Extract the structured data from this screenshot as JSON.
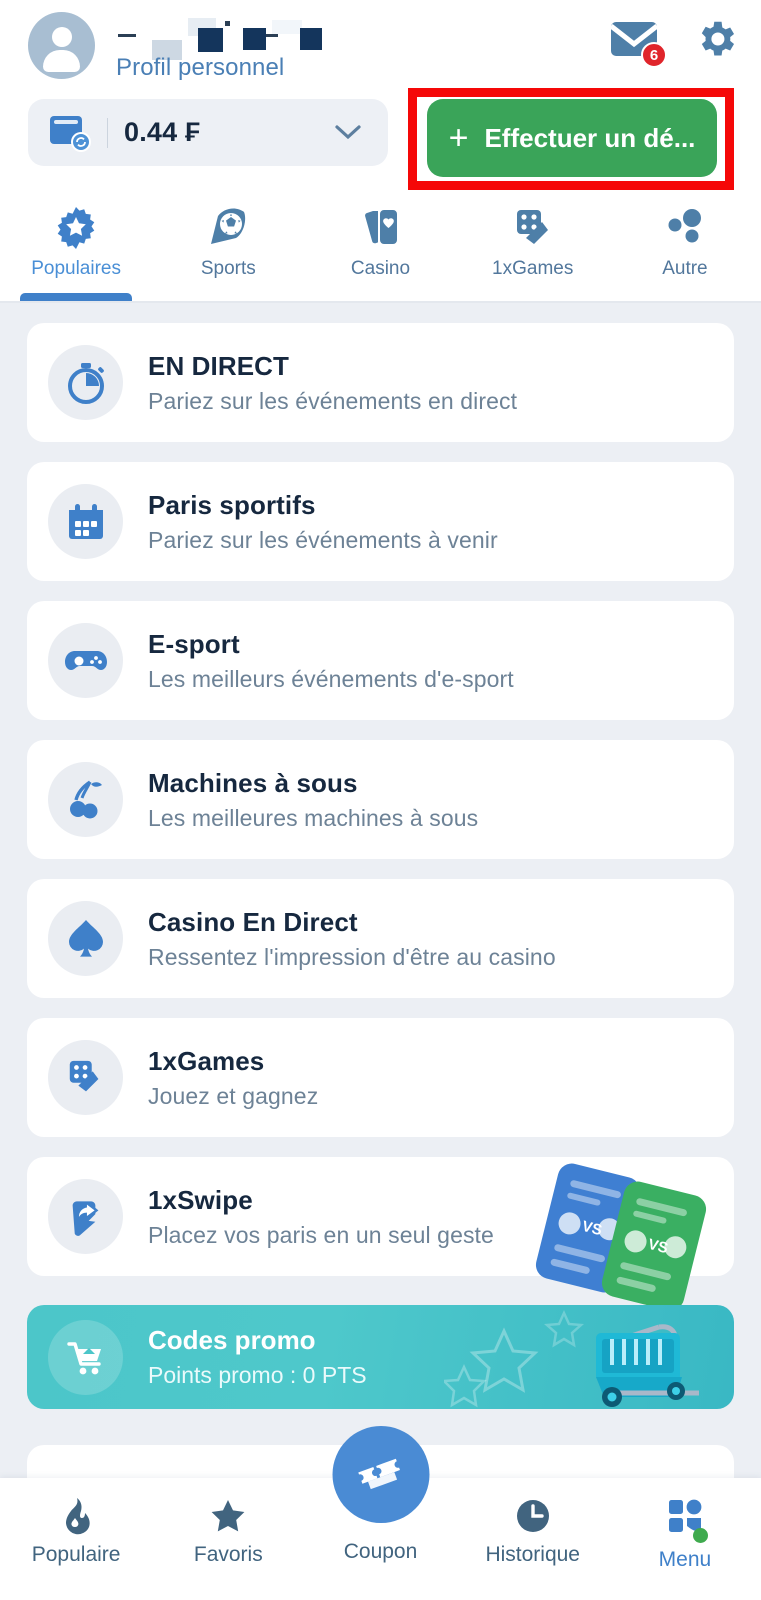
{
  "header": {
    "profile_label": "Profil personnel",
    "username_redacted": true,
    "mail_badge_count": "6",
    "balance_amount": "0.44 ₣",
    "deposit_label": "Effectuer un dé...",
    "deposit_plus": "+",
    "deposit_color": "#3aa459",
    "highlight_color": "#f50808"
  },
  "tabs": [
    {
      "label": "Populaires",
      "icon": "star-burst-icon",
      "active": true
    },
    {
      "label": "Sports",
      "icon": "football-icon",
      "active": false
    },
    {
      "label": "Casino",
      "icon": "playing-cards-icon",
      "active": false
    },
    {
      "label": "1xGames",
      "icon": "dice-icon",
      "active": false
    },
    {
      "label": "Autre",
      "icon": "more-dots-icon",
      "active": false
    }
  ],
  "list": [
    {
      "title": "EN DIRECT",
      "subtitle": "Pariez sur les événements en direct",
      "icon": "stopwatch-icon"
    },
    {
      "title": "Paris sportifs",
      "subtitle": "Pariez sur les événements à venir",
      "icon": "calendar-icon"
    },
    {
      "title": "E-sport",
      "subtitle": "Les meilleurs événements d'e-sport",
      "icon": "gamepad-icon"
    },
    {
      "title": "Machines à sous",
      "subtitle": "Les meilleures machines à sous",
      "icon": "cherries-icon"
    },
    {
      "title": "Casino En Direct",
      "subtitle": "Ressentez l'impression d'être au casino",
      "icon": "spade-icon"
    },
    {
      "title": "1xGames",
      "subtitle": "Jouez et gagnez",
      "icon": "dice-icon"
    },
    {
      "title": "1xSwipe",
      "subtitle": "Placez vos paris en un seul geste",
      "icon": "swipe-card-icon"
    }
  ],
  "swipe_art": {
    "vs_label": "VS",
    "blue": "#3f7fd2",
    "green": "#3aaf62"
  },
  "promo": {
    "title": "Codes promo",
    "subtitle": "Points promo : 0 PTS",
    "icon": "shopping-cart-icon",
    "color": "#4cc6c9"
  },
  "bottom_nav": [
    {
      "label": "Populaire",
      "icon": "flame-icon",
      "accent": false
    },
    {
      "label": "Favoris",
      "icon": "star-icon",
      "accent": false
    },
    {
      "label": "Coupon",
      "icon": "ticket-icon",
      "accent": false
    },
    {
      "label": "Historique",
      "icon": "clock-icon",
      "accent": false
    },
    {
      "label": "Menu",
      "icon": "grid-menu-icon",
      "accent": true
    }
  ]
}
